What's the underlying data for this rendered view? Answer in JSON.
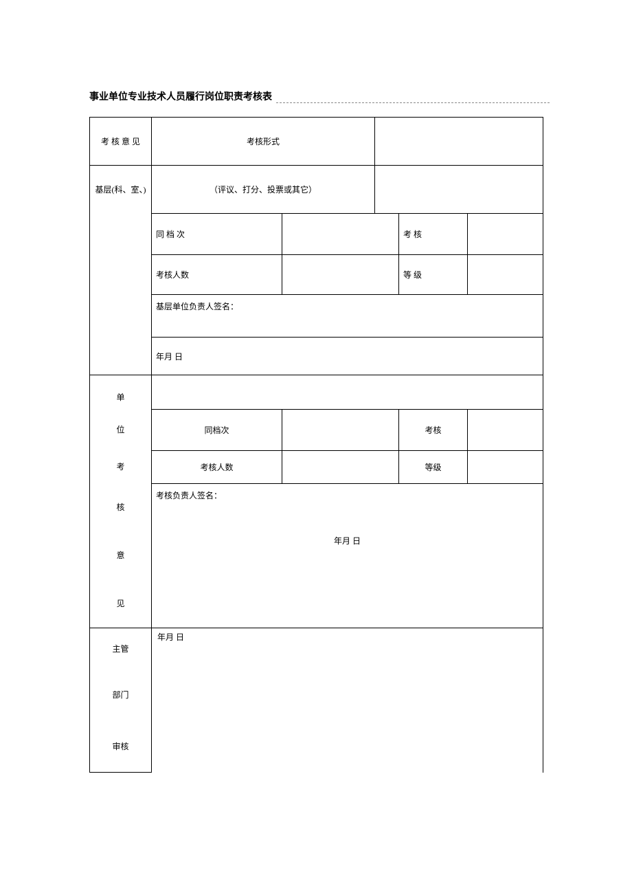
{
  "title": "事业单位专业技术人员履行岗位职责考核表",
  "labels": {
    "opinion_header": "考 核 意  见",
    "form_header": "考核形式",
    "base_layer": "基层(科、室、)",
    "form_note": "（评议、打分、投票或其它）",
    "same_level": "同 档 次",
    "assess": "考    核",
    "assess_people": "考核人数",
    "grade": "等   级",
    "base_signer": "基层单位负责人签名：",
    "ymd": "年月  日",
    "unit_block_1": "单",
    "unit_block_2": "位",
    "unit_block_3": "考",
    "unit_block_4": "核",
    "unit_block_5": "意",
    "unit_block_6": "见",
    "same_level2": "同档次",
    "assess2": "考核",
    "assess_people2": "考核人数",
    "grade2": "等级",
    "assess_signer": "考核负责人签名：",
    "dept_1": "主管",
    "dept_2": "部门",
    "dept_3": "审核"
  }
}
